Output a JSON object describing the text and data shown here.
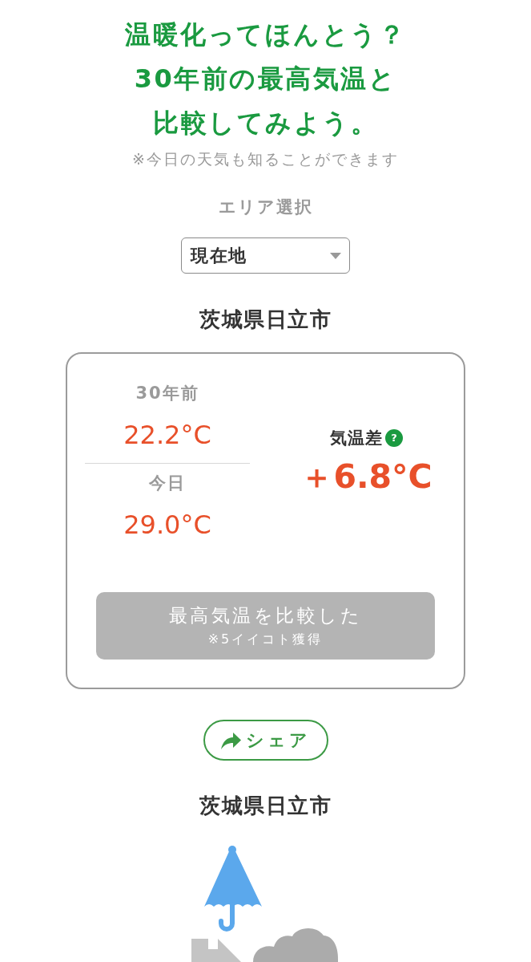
{
  "header": {
    "title_lines": [
      "温暖化ってほんとう？",
      "30年前の最高気温と",
      "比較してみよう。"
    ],
    "note": "※今日の天気も知ることができます"
  },
  "area_select": {
    "label": "エリア選択",
    "value": "現在地"
  },
  "location": "茨城県日立市",
  "comparison": {
    "readings": [
      {
        "label": "30年前",
        "temperature": "22.2°C"
      },
      {
        "label": "今日",
        "temperature": "29.0°C"
      }
    ],
    "difference": {
      "label": "気温差",
      "help_mark": "?",
      "value": "＋6.8°C"
    },
    "button": {
      "label": "最高気温を比較した",
      "note": "※5イイコト獲得",
      "disabled": true
    }
  },
  "share_button": {
    "label": "シェア"
  },
  "forecast": {
    "location": "茨城県日立市"
  }
}
